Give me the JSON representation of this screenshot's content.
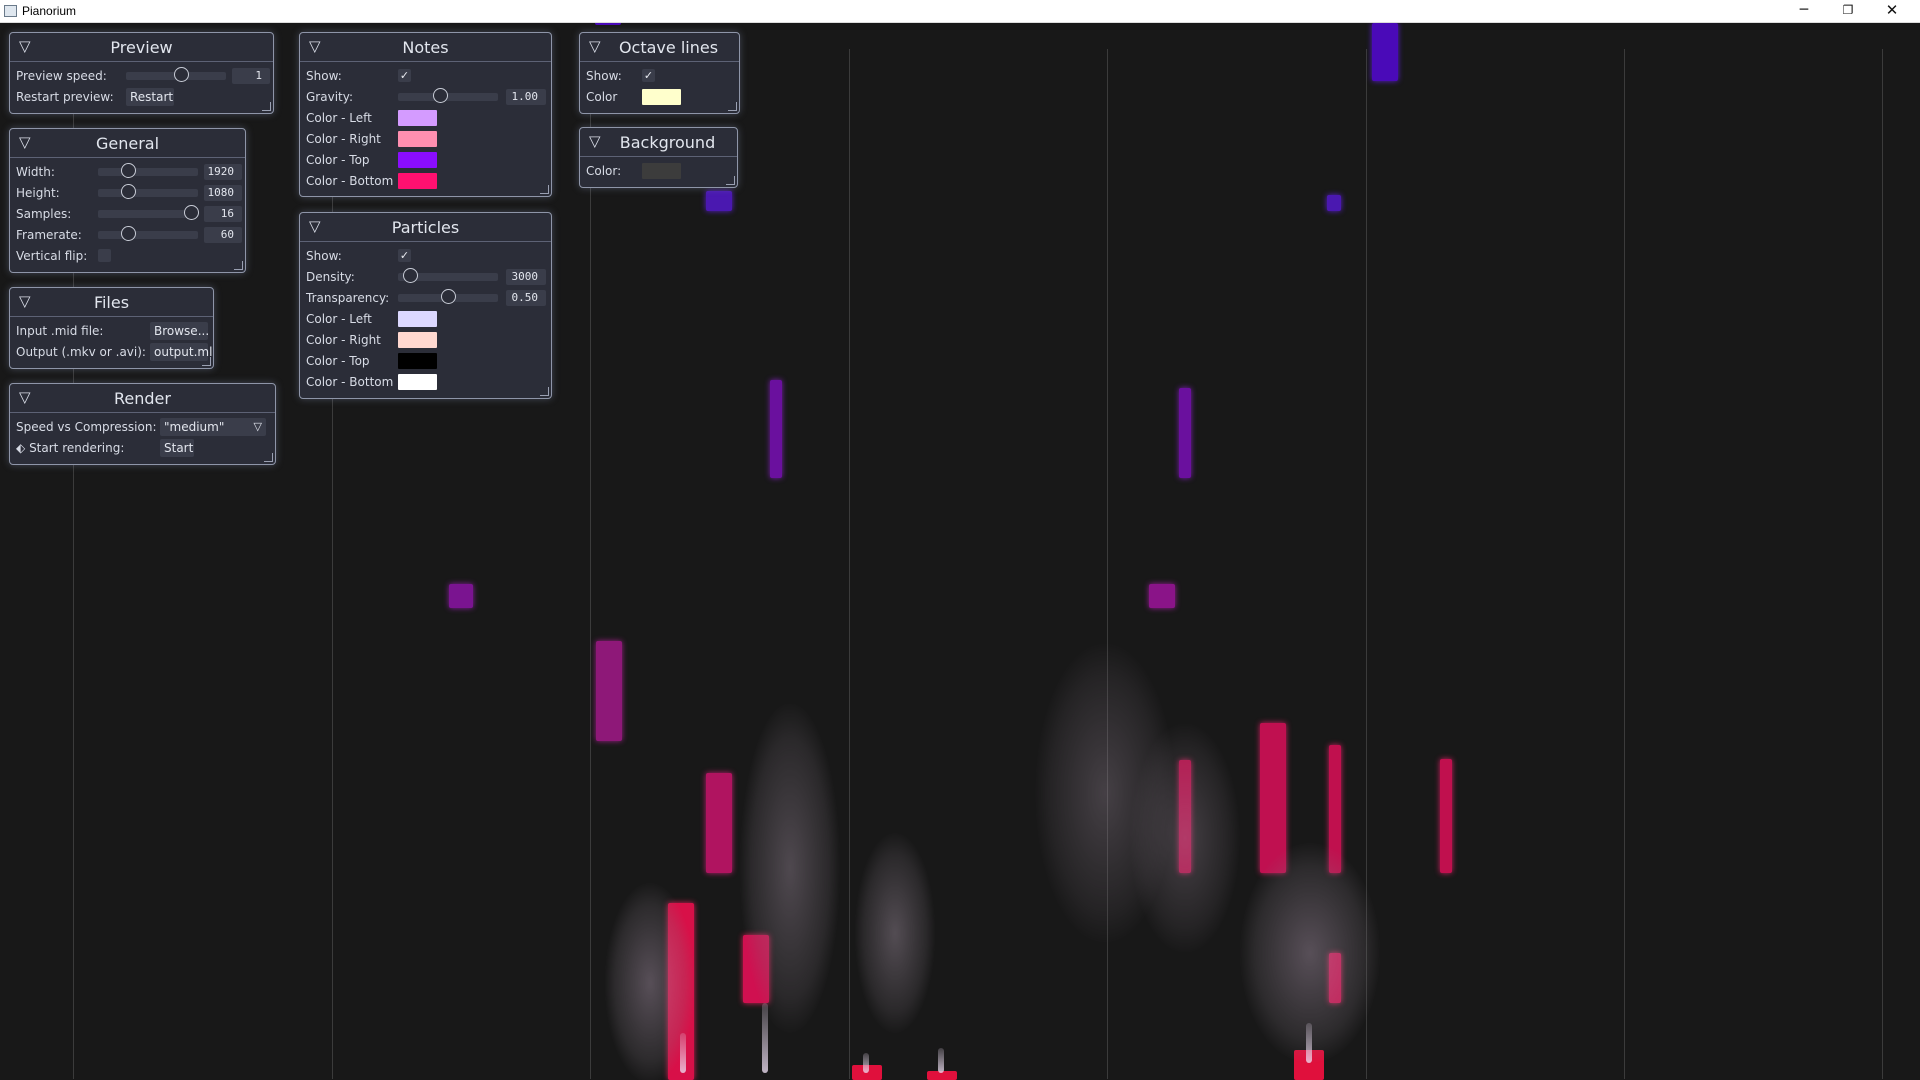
{
  "window": {
    "title": "Pianorium",
    "buttons": {
      "minimize": "─",
      "maximize": "❐",
      "close": "✕"
    }
  },
  "panels": {
    "preview": {
      "title": "Preview",
      "speed_label": "Preview speed:",
      "speed_value": "1",
      "speed_level": 0.55,
      "restart_label": "Restart preview:",
      "restart_button": "Restart"
    },
    "general": {
      "title": "General",
      "width_label": "Width:",
      "width_value": "1920",
      "width_level": 0.3,
      "height_label": "Height:",
      "height_value": "1080",
      "height_level": 0.3,
      "samples_label": "Samples:",
      "samples_value": "16",
      "samples_level": 0.93,
      "framerate_label": "Framerate:",
      "framerate_value": "60",
      "framerate_level": 0.3,
      "vflip_label": "Vertical flip:",
      "vflip_checked": false
    },
    "files": {
      "title": "Files",
      "input_label": "Input .mid file:",
      "input_button": "Browse...",
      "output_label": "Output (.mkv or .avi):",
      "output_value": "output.ml"
    },
    "render": {
      "title": "Render",
      "speed_label": "Speed vs Compression:",
      "speed_value": "\"medium\"",
      "start_icon": "arrow-icon",
      "start_label": "Start rendering:",
      "start_button": "Start"
    },
    "notes": {
      "title": "Notes",
      "show_label": "Show:",
      "show_checked": "✓",
      "gravity_label": "Gravity:",
      "gravity_value": "1.00",
      "gravity_level": 0.42,
      "color_left_label": "Color - Left",
      "color_left": "#d49bff",
      "color_right_label": "Color - Right",
      "color_right": "#ff8fb0",
      "color_top_label": "Color - Top",
      "color_top": "#8a0dff",
      "color_bottom_label": "Color - Bottom",
      "color_bottom": "#ff1070"
    },
    "particles": {
      "title": "Particles",
      "show_label": "Show:",
      "show_checked": "✓",
      "density_label": "Density:",
      "density_value": "3000",
      "density_level": 0.12,
      "transparency_label": "Transparency:",
      "transparency_value": "0.50",
      "transparency_level": 0.5,
      "color_left_label": "Color - Left",
      "color_left": "#dcd8ff",
      "color_right_label": "Color - Right",
      "color_right": "#ffd8d0",
      "color_top_label": "Color - Top",
      "color_top": "#000000",
      "color_bottom_label": "Color - Bottom",
      "color_bottom": "#ffffff"
    },
    "octave_lines": {
      "title": "Octave lines",
      "show_label": "Show:",
      "show_checked": "✓",
      "color_label": "Color",
      "color": "#ffffcc"
    },
    "background": {
      "title": "Background",
      "color_label": "Color:",
      "color": "#3c3c3c"
    }
  },
  "icons": {
    "collapse": "▽",
    "checkmark": "✓",
    "dropdown": "chevron-down-icon"
  }
}
